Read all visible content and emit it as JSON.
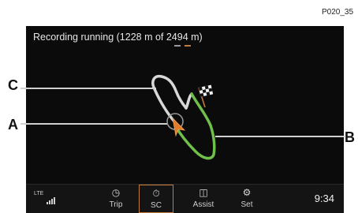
{
  "figure_id": "P020_35",
  "screen": {
    "status_text": "Recording running (1228 m of 2494 m)",
    "progress_fraction": 0.492,
    "colors": {
      "background": "#0b0b0b",
      "track_recorded": "#d8d8d8",
      "track_remaining": "#6fbf4a",
      "position_marker": "#e07b2a",
      "active_button_border": "#c27a3d"
    }
  },
  "map": {
    "icons": {
      "finish_flag": "checkered-flag-icon",
      "current_position": "arrow-position-icon"
    }
  },
  "bottom_bar": {
    "network": "LTE",
    "buttons": [
      {
        "label": "Trip",
        "icon": "gauge-icon"
      },
      {
        "label": "SC",
        "icon": "stopwatch-icon",
        "active": true
      },
      {
        "label": "Assist",
        "icon": "car-icon"
      },
      {
        "label": "Set",
        "icon": "settings-icon"
      }
    ],
    "clock": "9:34"
  },
  "callouts": {
    "a": "A",
    "b": "B",
    "c": "C"
  }
}
